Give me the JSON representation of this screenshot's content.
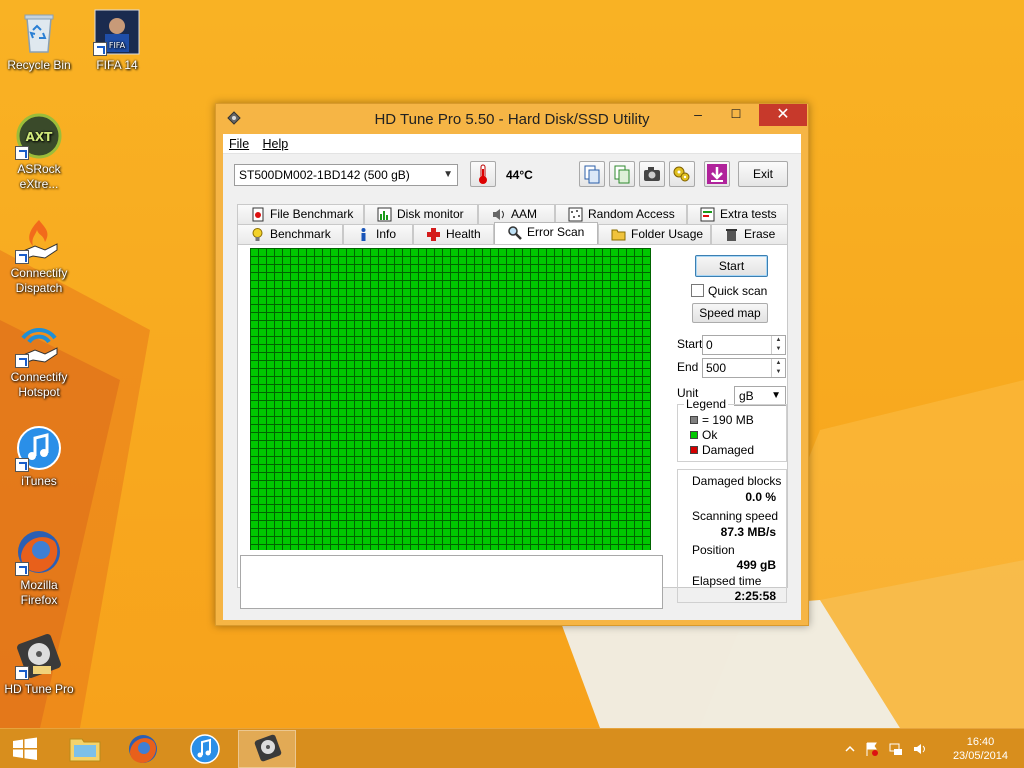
{
  "desktop": {
    "icons": [
      {
        "label": "Recycle Bin"
      },
      {
        "label": "FIFA 14"
      },
      {
        "label": "ASRock eXtre..."
      },
      {
        "label": "Connectify Dispatch"
      },
      {
        "label": "Connectify Hotspot"
      },
      {
        "label": "iTunes"
      },
      {
        "label": "Mozilla Firefox"
      },
      {
        "label": "HD Tune Pro"
      }
    ]
  },
  "window": {
    "title": "HD Tune Pro 5.50 - Hard Disk/SSD Utility",
    "controls": {
      "minimize": "–",
      "maximize": "☐",
      "close": "✕"
    },
    "menu": {
      "file": "File",
      "help": "Help"
    },
    "toolbar": {
      "drive": "ST500DM002-1BD142 (500 gB)",
      "temperature": "44°C",
      "exit": "Exit"
    },
    "tabs_row1": [
      "File Benchmark",
      "Disk monitor",
      "AAM",
      "Random Access",
      "Extra tests"
    ],
    "tabs_row2": [
      "Benchmark",
      "Info",
      "Health",
      "Error Scan",
      "Folder Usage",
      "Erase"
    ],
    "active_tab": "Error Scan",
    "panel": {
      "start_button": "Start",
      "quick_scan": "Quick scan",
      "quick_scan_checked": false,
      "speed_map": "Speed map",
      "start_label": "Start",
      "start_value": "0",
      "end_label": "End",
      "end_value": "500",
      "unit_label": "Unit",
      "unit_value": "gB",
      "legend": {
        "title": "Legend",
        "block_size": "= 190 MB",
        "ok": "Ok",
        "damaged": "Damaged",
        "colors": {
          "block": "#808080",
          "ok": "#00c800",
          "damaged": "#d40000"
        }
      },
      "stats": {
        "damaged_label": "Damaged blocks",
        "damaged_value": "0.0 %",
        "speed_label": "Scanning speed",
        "speed_value": "87.3 MB/s",
        "position_label": "Position",
        "position_value": "499 gB",
        "elapsed_label": "Elapsed time",
        "elapsed_value": "2:25:58"
      },
      "grid_color": "#00c800",
      "grid_line_color": "#006400"
    }
  },
  "taskbar": {
    "time": "16:40",
    "date": "23/05/2014"
  }
}
